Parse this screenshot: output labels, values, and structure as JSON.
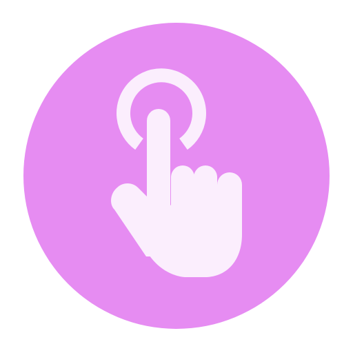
{
  "icon": {
    "name": "tap-gesture-icon",
    "background_color": "#e68cf2",
    "foreground_color": "#fbeefd"
  }
}
